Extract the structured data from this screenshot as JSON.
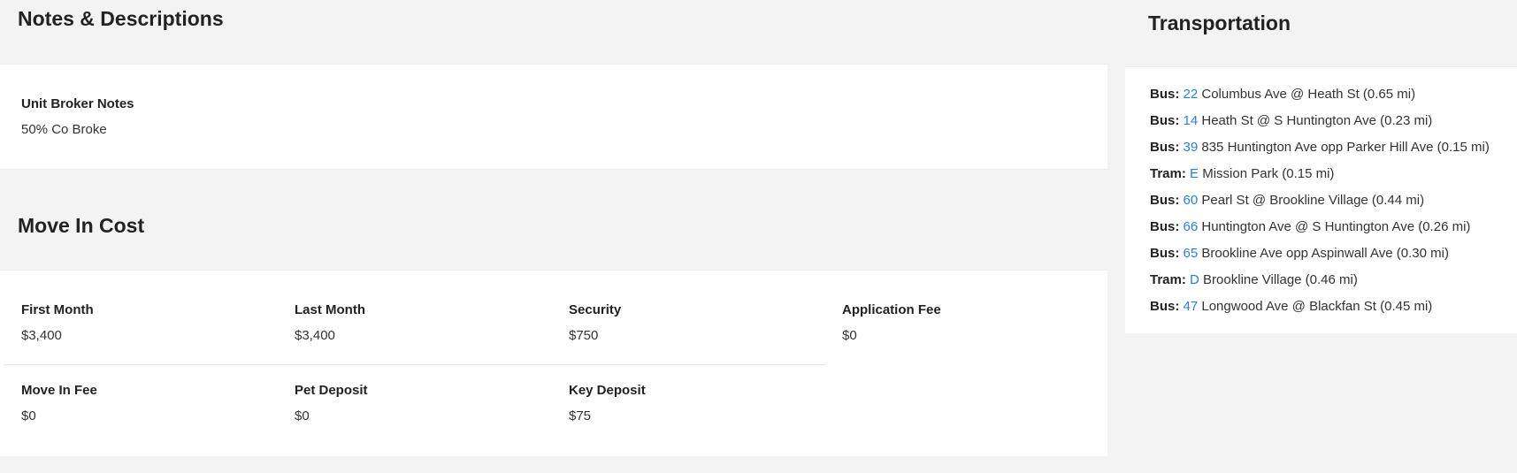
{
  "notes": {
    "title": "Notes & Descriptions",
    "field_label": "Unit Broker Notes",
    "field_value": "50% Co Broke"
  },
  "move_in": {
    "title": "Move In Cost",
    "items": [
      {
        "label": "First Month",
        "value": "$3,400"
      },
      {
        "label": "Last Month",
        "value": "$3,400"
      },
      {
        "label": "Security",
        "value": "$750"
      },
      {
        "label": "Application Fee",
        "value": "$0"
      },
      {
        "label": "Move In Fee",
        "value": "$0"
      },
      {
        "label": "Pet Deposit",
        "value": "$0"
      },
      {
        "label": "Key Deposit",
        "value": "$75"
      }
    ]
  },
  "transportation": {
    "title": "Transportation",
    "items": [
      {
        "mode": "Bus:",
        "route": "22",
        "stop": "Columbus Ave @ Heath St (0.65 mi)"
      },
      {
        "mode": "Bus:",
        "route": "14",
        "stop": "Heath St @ S Huntington Ave (0.23 mi)"
      },
      {
        "mode": "Bus:",
        "route": "39",
        "stop": "835 Huntington Ave opp Parker Hill Ave (0.15 mi)"
      },
      {
        "mode": "Tram:",
        "route": "E",
        "stop": "Mission Park (0.15 mi)"
      },
      {
        "mode": "Bus:",
        "route": "60",
        "stop": "Pearl St @ Brookline Village (0.44 mi)"
      },
      {
        "mode": "Bus:",
        "route": "66",
        "stop": "Huntington Ave @ S Huntington Ave (0.26 mi)"
      },
      {
        "mode": "Bus:",
        "route": "65",
        "stop": "Brookline Ave opp Aspinwall Ave (0.30 mi)"
      },
      {
        "mode": "Tram:",
        "route": "D",
        "stop": "Brookline Village (0.46 mi)"
      },
      {
        "mode": "Bus:",
        "route": "47",
        "stop": "Longwood Ave @ Blackfan St (0.45 mi)"
      }
    ],
    "link_color": "#2d7ed6"
  }
}
